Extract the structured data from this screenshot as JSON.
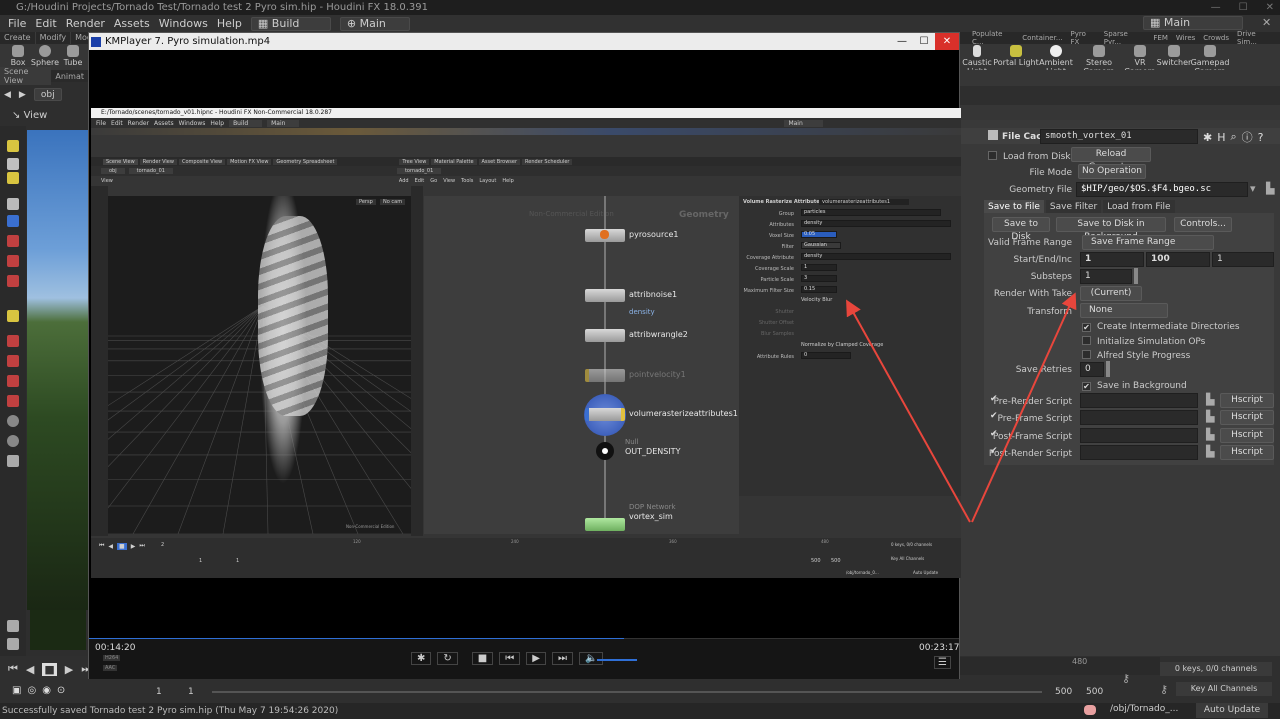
{
  "window_title": "G:/Houdini Projects/Tornado Test/Tornado test 2 Pyro sim.hip - Houdini FX 18.0.391",
  "menu": [
    "File",
    "Edit",
    "Render",
    "Assets",
    "Windows",
    "Help"
  ],
  "desktop_build": "Build",
  "desktop_main": "Main",
  "shelf_tabs_left": [
    "Create",
    "Modify",
    "Model"
  ],
  "shelf_tabs_right": [
    "Populate C...",
    "Container...",
    "Pyro FX",
    "Sparse Pyr...",
    "FEM",
    "Wires",
    "Crowds",
    "Drive Sim..."
  ],
  "shelf_tools_left": [
    "Box",
    "Sphere",
    "Tube"
  ],
  "shelf_tools_right": [
    "Caustic Light",
    "Portal Light",
    "Ambient Light",
    "Stereo Camera",
    "VR Camera",
    "Switcher",
    "Gamepad Camera"
  ],
  "left_tabs": [
    "Scene View",
    "Animat"
  ],
  "left_path": "obj",
  "left_view": "View",
  "kmplayer": {
    "title": "KMPlayer 7. Pyro simulation.mp4",
    "time_elapsed": "00:14:20",
    "time_total": "00:23:17",
    "progress": 0.615,
    "codec1": "H264",
    "codec2": "AAC"
  },
  "inner": {
    "title": "E:/Tornado/scenes/tornado_v01.hipnc - Houdini FX Non-Commercial 18.0.287",
    "menu": [
      "File",
      "Edit",
      "Render",
      "Assets",
      "Windows",
      "Help"
    ],
    "build": "Build",
    "main": "Main",
    "left_tabs": [
      "Scene View",
      "Render View",
      "Composite View",
      "Motion FX View",
      "Geometry Spreadsheet"
    ],
    "right_tabs": [
      "Tree View",
      "Material Palette",
      "Asset Browser",
      "Render Scheduler"
    ],
    "path_left": "obj",
    "path_left2": "tornado_01",
    "path_right": "tornado_01",
    "view": "View",
    "persp": "Persp",
    "cam": "No cam",
    "ne_menu": [
      "Add",
      "Edit",
      "Go",
      "View",
      "Tools",
      "Layout",
      "Help"
    ],
    "ne_watermark": "Non-Commercial Edition",
    "ne_context": "Geometry",
    "nodes": [
      {
        "name": "pyrosource1",
        "sub": ""
      },
      {
        "name": "attribnoise1",
        "sub": "density"
      },
      {
        "name": "attribwrangle2",
        "sub": ""
      },
      {
        "name": "pointvelocity1",
        "sub": ""
      },
      {
        "name": "volumerasterizeattributes1",
        "sub": ""
      },
      {
        "name": "OUT_DENSITY",
        "sub": "Null"
      },
      {
        "name": "vortex_sim",
        "sub": "DOP Network"
      }
    ],
    "params": {
      "header": "Volume Rasterize Attributes",
      "node": "volumerasterizeattributes1",
      "rows": [
        {
          "label": "Group",
          "value": "particles"
        },
        {
          "label": "Attributes",
          "value": "density"
        },
        {
          "label": "Voxel Size",
          "value": "0.05"
        },
        {
          "label": "Filter",
          "value": "Gaussian"
        },
        {
          "label": "Coverage Attribute",
          "value": "density"
        },
        {
          "label": "Coverage Scale",
          "value": "1"
        },
        {
          "label": "Particle Scale",
          "value": "3"
        },
        {
          "label": "Maximum Filter Size",
          "value": "0.15"
        }
      ],
      "velocity_blur": "Velocity Blur",
      "dim_rows": [
        "Shutter",
        "Shutter Offset",
        "Blur Samples"
      ],
      "normalize": "Normalize by Clamped Coverage",
      "attr_rules": "Attribute Rules",
      "attr_rules_val": "0"
    },
    "timeline": {
      "frame": "2",
      "ticks": [
        "120",
        "240",
        "360",
        "480"
      ],
      "start": "1",
      "start2": "1",
      "end": "500",
      "end2": "500",
      "keys": "0 keys, 0/0 channels",
      "key_all": "Key All Channels",
      "path": "/obj/tornado_0...",
      "auto": "Auto Update",
      "watermark": "Non-Commercial Edition"
    }
  },
  "right_panel": {
    "node_type": "File Cache",
    "node_name": "smooth_vortex_01",
    "load_from_disk": "Load from Disk",
    "reload": "Reload Geometry",
    "file_mode_label": "File Mode",
    "file_mode": "No Operation",
    "geo_file_label": "Geometry File",
    "geo_file": "$HIP/geo/$OS.$F4.bgeo.sc",
    "tabs": [
      "Save to File",
      "Save Filter",
      "Load from File"
    ],
    "btn_save": "Save to Disk",
    "btn_save_bg": "Save to Disk in Background",
    "btn_controls": "Controls...",
    "valid_range_label": "Valid Frame Range",
    "valid_range": "Save Frame Range",
    "start_label": "Start/End/Inc",
    "start": "1",
    "end": "100",
    "inc": "1",
    "substeps_label": "Substeps",
    "substeps": "1",
    "render_take_label": "Render With Take",
    "render_take": "(Current)",
    "transform_label": "Transform",
    "transform": "None",
    "opt1": "Create Intermediate Directories",
    "opt2": "Initialize Simulation OPs",
    "opt3": "Alfred Style Progress",
    "retries_label": "Save Retries",
    "retries": "0",
    "bg": "Save in Background",
    "scripts": [
      "Pre-Render Script",
      "Pre-Frame Script",
      "Post-Frame Script",
      "Post-Render Script"
    ],
    "hscript": "Hscript"
  },
  "bottom": {
    "frame": "1",
    "start": "1",
    "ticks": [
      "480"
    ],
    "end": "500",
    "end2": "500",
    "keys": "0 keys, 0/0 channels",
    "key_all": "Key All Channels",
    "path": "/obj/Tornado_...",
    "auto": "Auto Update",
    "status": "Successfully saved Tornado test 2 Pyro sim.hip (Thu May  7 19:54:26 2020)"
  },
  "colors": {
    "arrow": "#e8463c",
    "node_blue": "#3a6fd0",
    "node_green": "#8fd07a",
    "node_yellow": "#e0c040",
    "play_blue": "#2f6fd6"
  }
}
